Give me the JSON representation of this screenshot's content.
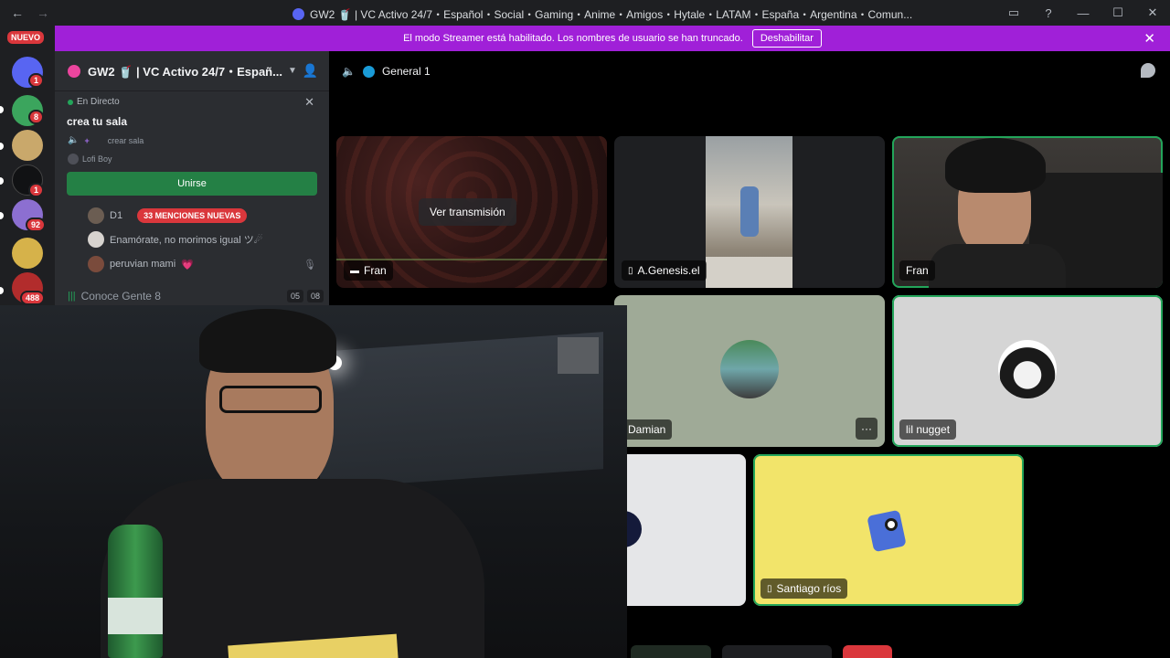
{
  "window": {
    "title": "GW2 🥤 | VC Activo 24/7・Español・Social・Gaming・Anime・Amigos・Hytale・LATAM・España・Argentina・Comun...",
    "nav_back": "←",
    "nav_forward": "→",
    "controls": [
      "▭",
      "?",
      "—",
      "☐",
      "✕"
    ]
  },
  "banner": {
    "text": "El modo Streamer está habilitado. Los nombres de usuario se han truncado.",
    "button_label": "Deshabilitar",
    "close": "✕"
  },
  "rail": {
    "nuevo_label": "NUEVO",
    "servers": [
      {
        "badge": "1",
        "color": "#5865f2"
      },
      {
        "badge": "8",
        "color": "#3ba55d"
      },
      {
        "badge": "",
        "color": "#c9a86b"
      },
      {
        "badge": "1",
        "color": "#111214"
      },
      {
        "badge": "92",
        "color": "#8c6fd1"
      },
      {
        "badge": "",
        "color": "#d6b24a"
      },
      {
        "badge": "488",
        "color": "#b22c2c"
      }
    ]
  },
  "sidebar": {
    "server_name": "GW2 🥤 | VC Activo 24/7・Españ...",
    "live": {
      "label": "En Directo",
      "close": "✕",
      "title": "crea tu sala",
      "sub": "crear sala",
      "user": "Lofi Boy",
      "join_label": "Unirse"
    },
    "rows": [
      {
        "name": "D1",
        "mention": "33 MENCIONES NUEVAS"
      },
      {
        "name": "Enamórate, no morimos igual  ツ☄"
      },
      {
        "name": "peruvian mami",
        "heart": "💗"
      }
    ],
    "voice_channel": {
      "name": "Conoce Gente 8",
      "count_a": "05",
      "count_b": "08"
    }
  },
  "voice": {
    "channel_name": "General 1",
    "tiles": [
      {
        "name": "Fran",
        "action": "Ver transmisión",
        "type": "stream"
      },
      {
        "name": "A.Genesis.el",
        "type": "camera"
      },
      {
        "name": "Fran",
        "type": "camera"
      },
      {
        "name": "Damian",
        "more": "···",
        "type": "avatar"
      },
      {
        "name": "lil nugget",
        "type": "avatar"
      },
      {
        "name": "Santiago ríos",
        "type": "avatar"
      }
    ]
  }
}
